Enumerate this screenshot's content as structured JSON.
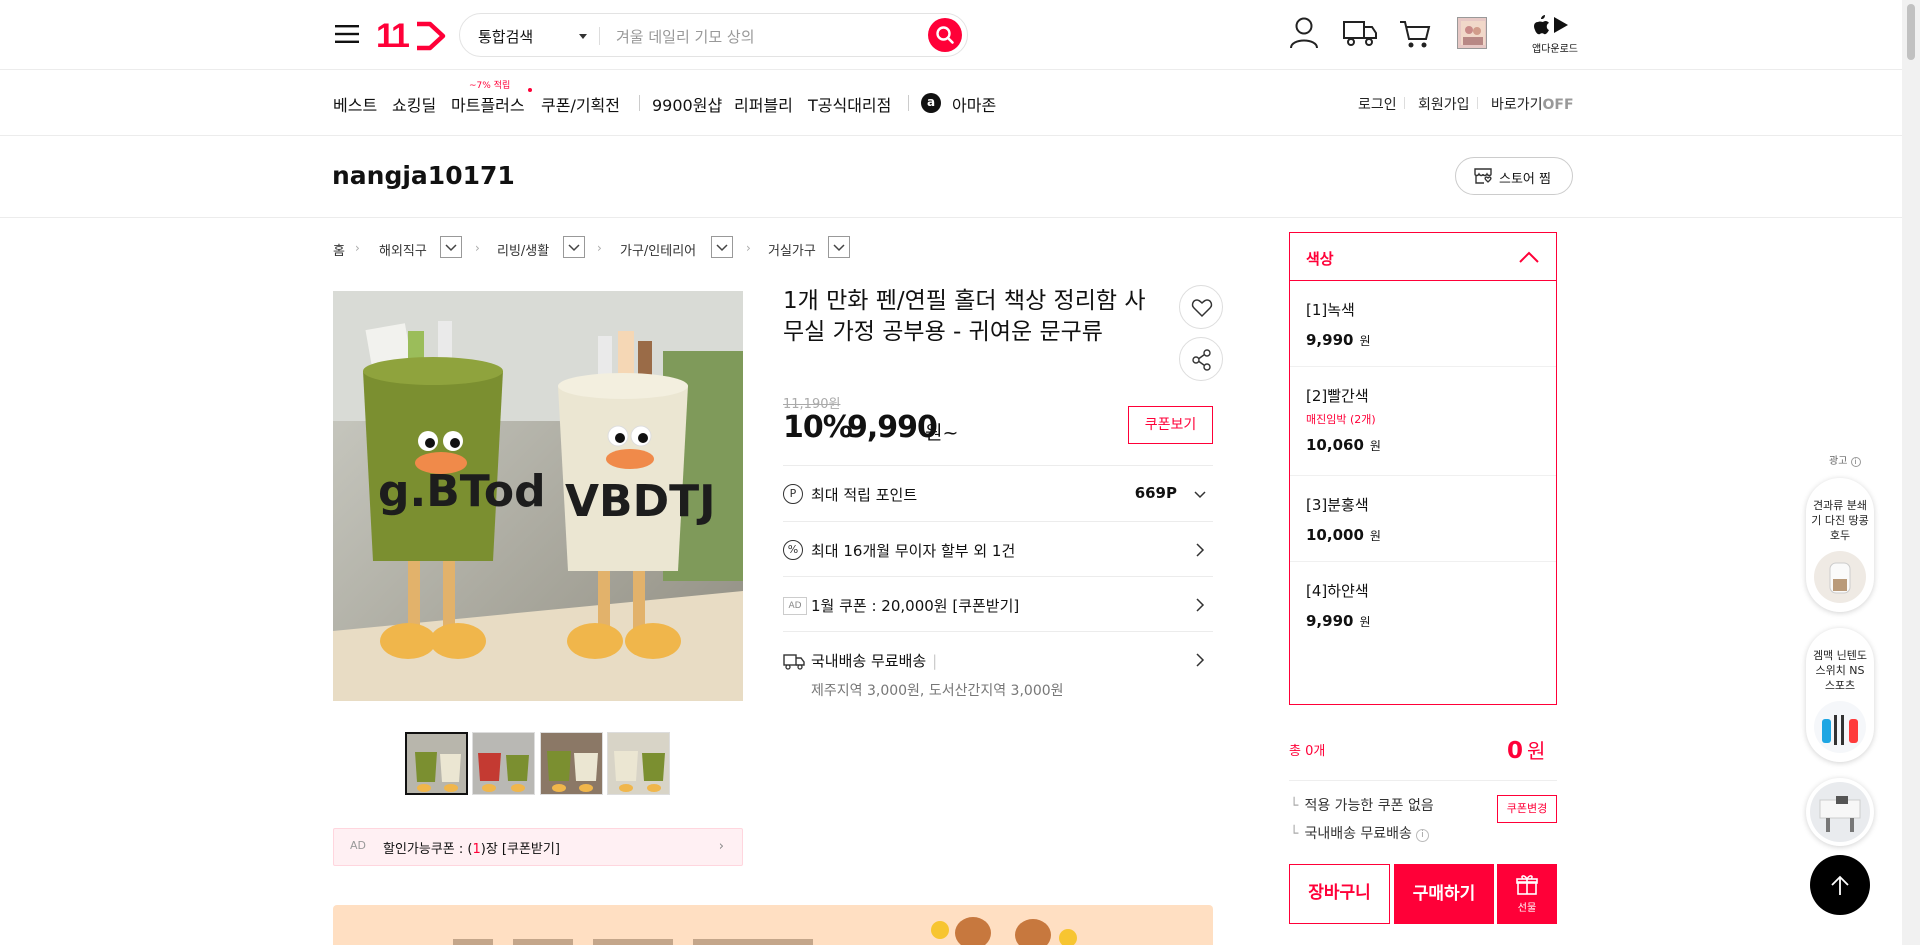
{
  "header": {
    "logo_text": "11",
    "search": {
      "category": "통합검색",
      "placeholder": "겨울 데일리 기모 상의"
    },
    "app_download": "앱다운로드"
  },
  "gnb": {
    "items": [
      "베스트",
      "쇼킹딜",
      "마트플러스",
      "쿠폰/기획전",
      "9900원샵",
      "리퍼블리",
      "T공식대리점",
      "아마존"
    ],
    "mart_badge": "~7% 적립",
    "amazon_icon_letter": "a",
    "right": {
      "login": "로그인",
      "signup": "회원가입",
      "shortcut": "바로가기",
      "shortcut_state": "OFF"
    }
  },
  "store": {
    "name": "nangja10171",
    "follow": "스토어 찜"
  },
  "breadcrumb": [
    "홈",
    "해외직구",
    "리빙/생활",
    "가구/인테리어",
    "거실가구"
  ],
  "product": {
    "title": "1개 만화 펜/연필 홀더 책상 정리함 사무실 가정 공부용 - 귀여운 문구류",
    "original_price": "11,190원",
    "discount": "10%",
    "price": "9,990",
    "price_unit": "원~",
    "coupon_view": "쿠폰보기",
    "point_label": "최대 적립 포인트",
    "point_value": "669P",
    "installment": "최대 16개월 무이자 할부 외 1건",
    "ad_tag": "AD",
    "ad_coupon": "1월 쿠폰 : 20,000원 [쿠폰받기]",
    "shipping": "국내배송 무료배송",
    "shipping_extra": "제주지역 3,000원, 도서산간지역 3,000원",
    "discount_coupon_ad": "AD",
    "discount_coupon_prefix": "할인가능쿠폰 : (",
    "discount_coupon_count": "1",
    "discount_coupon_suffix": ")장 [쿠폰받기]"
  },
  "options": {
    "header": "색상",
    "items": [
      {
        "name": "[1]녹색",
        "status": "",
        "price": "9,990",
        "unit": "원"
      },
      {
        "name": "[2]빨간색",
        "status": "매진임박 (2개)",
        "price": "10,060",
        "unit": "원"
      },
      {
        "name": "[3]분홍색",
        "status": "",
        "price": "10,000",
        "unit": "원"
      },
      {
        "name": "[4]하얀색",
        "status": "",
        "price": "9,990",
        "unit": "원"
      }
    ]
  },
  "summary": {
    "total_label": "총 0개",
    "total_value": "0",
    "total_unit": "원",
    "no_coupon": "적용 가능한 쿠폰 없음",
    "coupon_change": "쿠폰변경",
    "free_shipping": "국내배송 무료배송",
    "cart": "장바구니",
    "buy": "구매하기",
    "gift": "선물"
  },
  "ad_rail": {
    "label": "광고",
    "cards": [
      "견과류 분쇄기 다진 땅콩 호두",
      "겜맥 닌텐도 스위치 NS 스포츠",
      ""
    ]
  }
}
